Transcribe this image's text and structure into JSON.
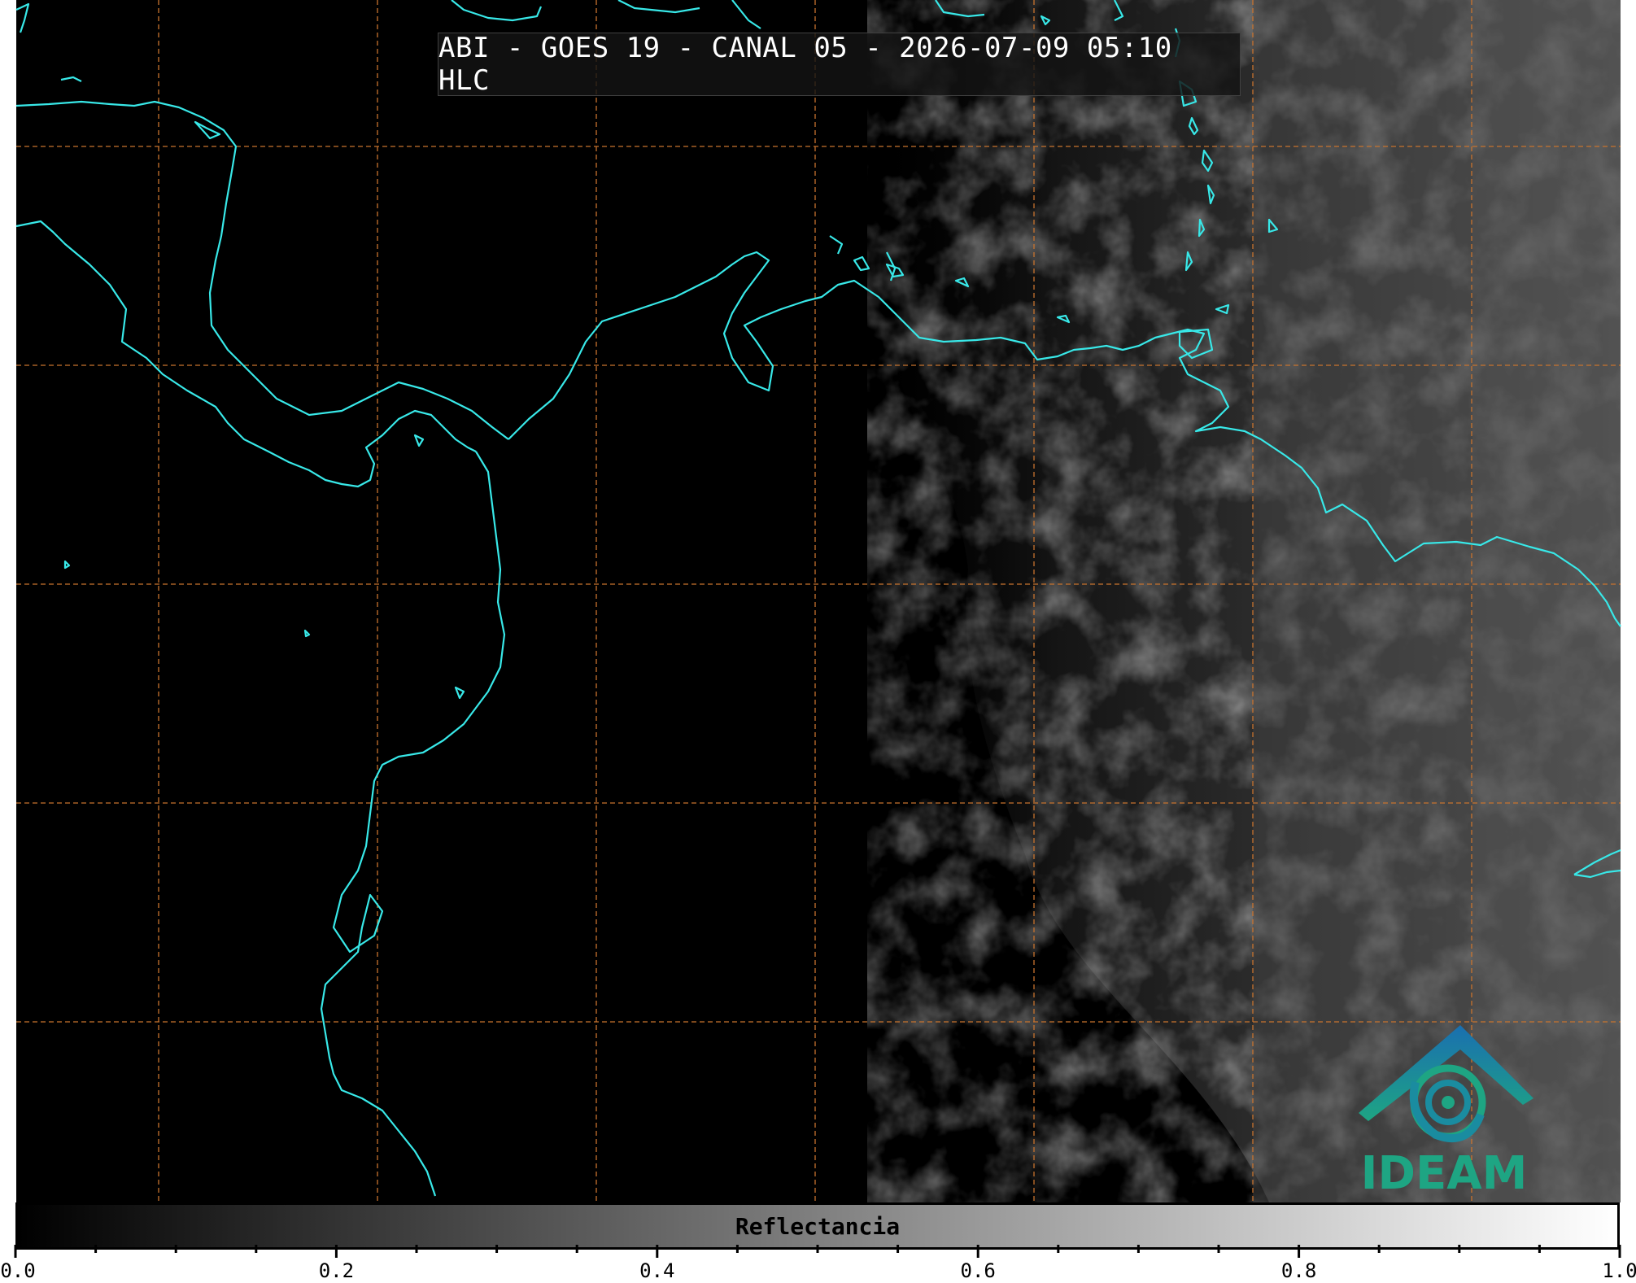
{
  "title": "ABI - GOES 19 - CANAL 05 - 2026-07-09 05:10 HLC",
  "colorbar": {
    "label": "Reflectancia",
    "min": 0.0,
    "max": 1.0,
    "tick_labels": [
      "0.0",
      "0.2",
      "0.4",
      "0.6",
      "0.8",
      "1.0"
    ],
    "major_values": [
      0.0,
      0.2,
      0.4,
      0.6,
      0.8,
      1.0
    ],
    "minor_step": 0.05
  },
  "logo": {
    "text": "IDEAM"
  },
  "colors": {
    "background": "#000000",
    "coastline": "#38e8e8",
    "graticule": "#c8732e",
    "logo_green": "#1ea583",
    "logo_blue": "#1a6fb0"
  }
}
